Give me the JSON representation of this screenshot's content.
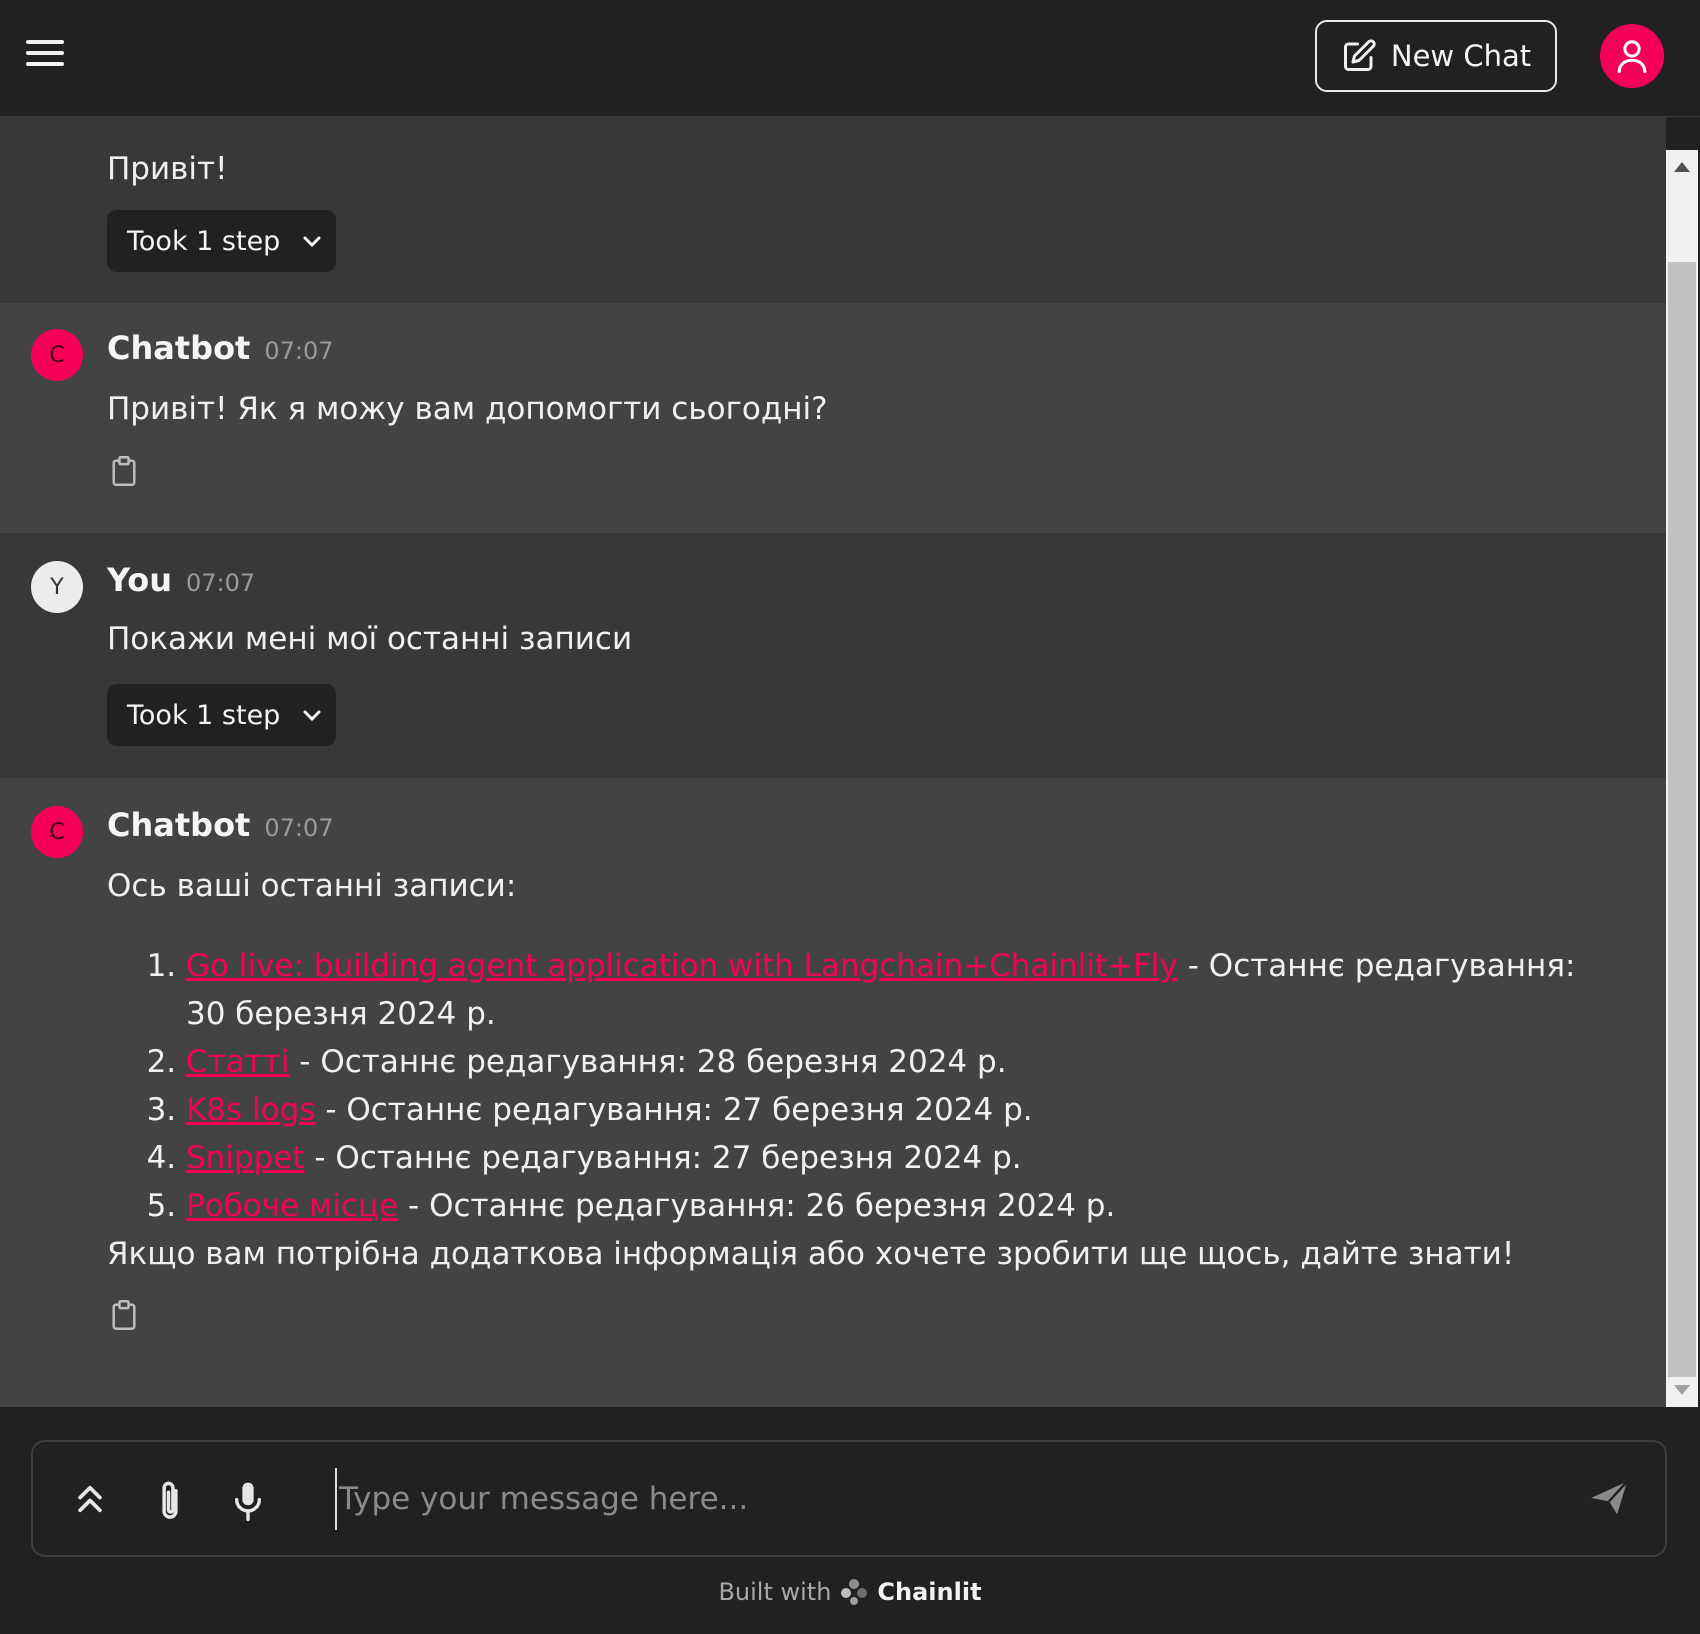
{
  "header": {
    "new_chat_label": "New Chat"
  },
  "messages": [
    {
      "text": "Привіт!",
      "step_label": "Took 1 step"
    },
    {
      "author": "Chatbot",
      "avatar_letter": "C",
      "time": "07:07",
      "text": "Привіт! Як я можу вам допомогти сьогодні?"
    },
    {
      "author": "You",
      "avatar_letter": "Y",
      "time": "07:07",
      "text": "Покажи мені мої останні записи",
      "step_label": "Took 1 step"
    },
    {
      "author": "Chatbot",
      "avatar_letter": "C",
      "time": "07:07",
      "intro": "Ось ваші останні записи:",
      "records": [
        {
          "title": "Go live: building agent application with Langchain+Chainlit+Fly",
          "suffix": " - Останнє редагування: 30 березня 2024 р."
        },
        {
          "title": "Статті",
          "suffix": " - Останнє редагування: 28 березня 2024 р."
        },
        {
          "title": "K8s logs",
          "suffix": " - Останнє редагування: 27 березня 2024 р."
        },
        {
          "title": "Snippet",
          "suffix": " - Останнє редагування: 27 березня 2024 р."
        },
        {
          "title": "Робоче місце",
          "suffix": " - Останнє редагування: 26 березня 2024 р."
        }
      ],
      "outro": "Якщо вам потрібна додаткова інформація або хочете зробити ще щось, дайте знати!"
    }
  ],
  "composer": {
    "placeholder": "Type your message here..."
  },
  "footer": {
    "built_with": "Built with",
    "brand": "Chainlit"
  },
  "colors": {
    "accent": "#f50057",
    "background": "#212121",
    "message_dark": "#383838",
    "message_light": "#434343"
  }
}
